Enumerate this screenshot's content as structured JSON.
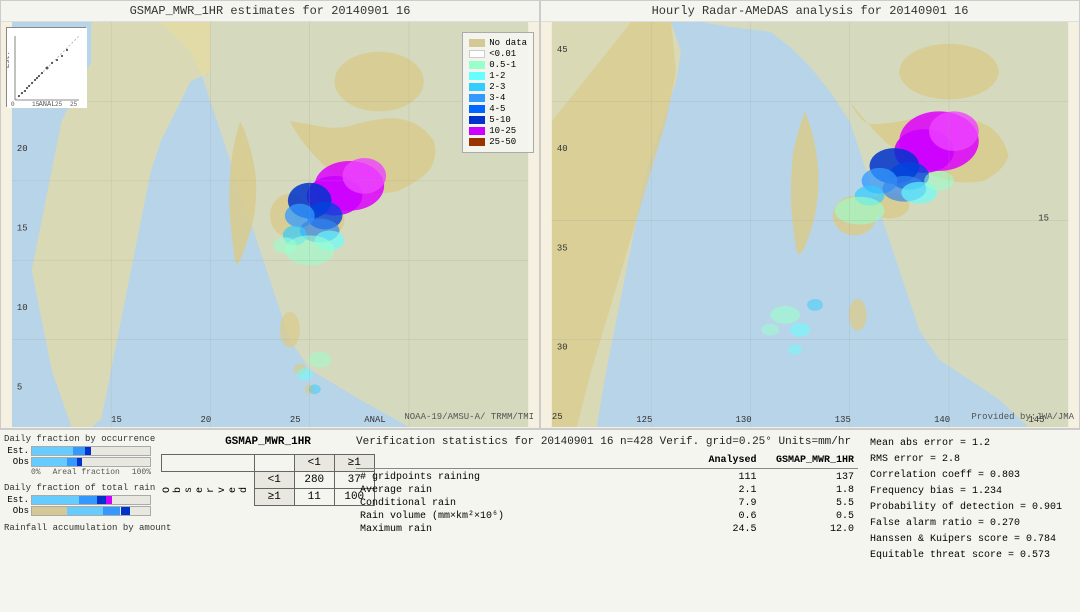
{
  "leftMap": {
    "title": "GSMAP_MWR_1HR estimates for 20140901 16",
    "attribution": "NOAA-19/AMSU-A/\nTRMM/TMI"
  },
  "rightMap": {
    "title": "Hourly Radar-AMeDAS analysis for 20140901 16",
    "attribution": "Provided by:JWA/JMA"
  },
  "legend": {
    "title": "",
    "items": [
      {
        "label": "No data",
        "color": "#d4c896"
      },
      {
        "label": "<0.01",
        "color": "#ffffff"
      },
      {
        "label": "0.5-1",
        "color": "#99ffcc"
      },
      {
        "label": "1-2",
        "color": "#66ffff"
      },
      {
        "label": "2-3",
        "color": "#33ccff"
      },
      {
        "label": "3-4",
        "color": "#3399ff"
      },
      {
        "label": "4-5",
        "color": "#0066ff"
      },
      {
        "label": "5-10",
        "color": "#0033cc"
      },
      {
        "label": "10-25",
        "color": "#cc00ff"
      },
      {
        "label": "25-50",
        "color": "#993300"
      }
    ]
  },
  "barCharts": {
    "title1": "Daily fraction by occurrence",
    "title2": "Daily fraction of total rain",
    "title3": "Rainfall accumulation by amount",
    "labels": [
      "Est.",
      "Obs"
    ],
    "bars1_est": 35,
    "bars1_obs": 30,
    "bars2_est": 40,
    "bars2_obs": 55,
    "axisLabels": [
      "0%",
      "Areal fraction",
      "100%"
    ]
  },
  "contingency": {
    "title": "GSMAP_MWR_1HR",
    "colHeaders": [
      "<1",
      "≥1"
    ],
    "rowHeaders": [
      "<1",
      "≥1"
    ],
    "obsLabel": "O\nb\ns\ne\nr\nv\ne\nd",
    "cells": [
      [
        280,
        37
      ],
      [
        11,
        100
      ]
    ]
  },
  "verification": {
    "title": "Verification statistics for 20140901 16  n=428  Verif. grid=0.25°  Units=mm/hr",
    "columnHeaders": [
      "Analysed",
      "GSMAP_MWR_1HR"
    ],
    "rows": [
      {
        "label": "# gridpoints raining",
        "val1": "111",
        "val2": "137"
      },
      {
        "label": "Average rain",
        "val1": "2.1",
        "val2": "1.8"
      },
      {
        "label": "Conditional rain",
        "val1": "7.9",
        "val2": "5.5"
      },
      {
        "label": "Rain volume (mm×km²×10⁶)",
        "val1": "0.6",
        "val2": "0.5"
      },
      {
        "label": "Maximum rain",
        "val1": "24.5",
        "val2": "12.0"
      }
    ]
  },
  "rightStats": {
    "lines": [
      "Mean abs error = 1.2",
      "RMS error = 2.8",
      "Correlation coeff = 0.803",
      "Frequency bias = 1.234",
      "Probability of detection = 0.901",
      "False alarm ratio = 0.270",
      "Hanssen & Kuipers score = 0.784",
      "Equitable threat score = 0.573"
    ]
  }
}
